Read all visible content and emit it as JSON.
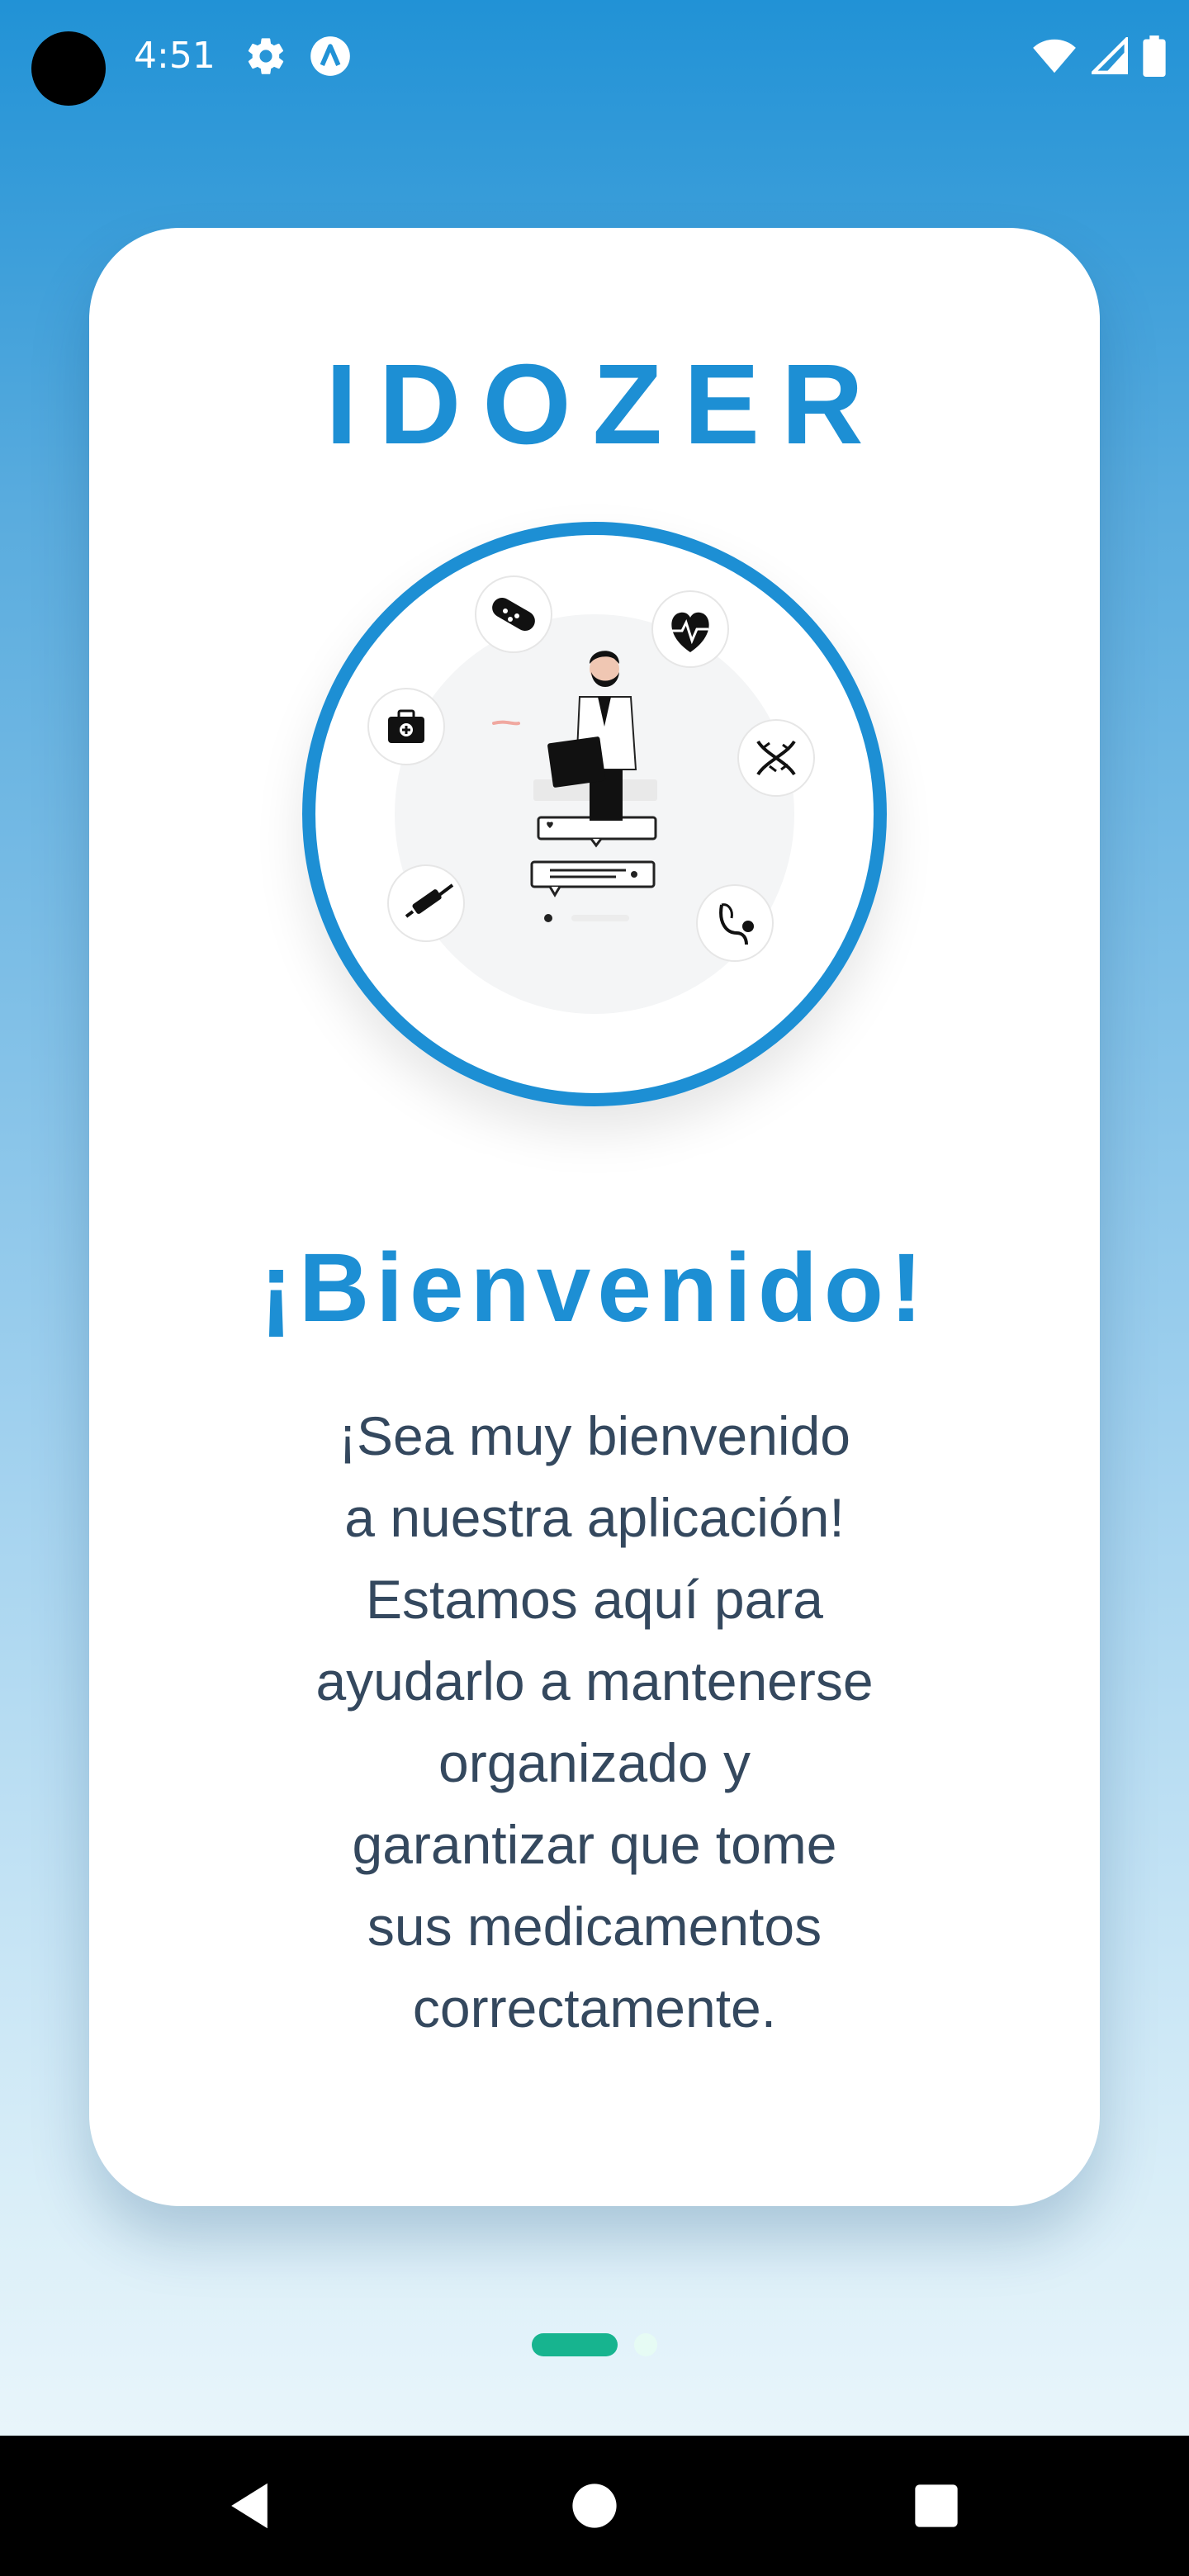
{
  "status_bar": {
    "time": "4:51",
    "icons": [
      "settings-icon",
      "app-notification-icon",
      "wifi-icon",
      "signal-icon",
      "battery-icon"
    ]
  },
  "card": {
    "app_title": "IDOZER",
    "welcome_heading": "¡Bienvenido!",
    "welcome_lines": [
      "¡Sea muy bienvenido",
      "a nuestra aplicación!",
      "Estamos aquí para",
      "ayudarlo a mantenerse",
      "organizado y",
      "garantizar que tome",
      "sus medicamentos",
      "correctamente."
    ]
  },
  "illustration": {
    "icons": [
      "bandage-icon",
      "heart-rate-icon",
      "medical-kit-icon",
      "dna-icon",
      "syringe-icon",
      "stethoscope-icon",
      "doctor-figure"
    ]
  },
  "pager": {
    "pages": 2,
    "active": 1
  },
  "nav_bar": {
    "buttons": [
      "back-icon",
      "home-icon",
      "recents-icon"
    ]
  },
  "colors": {
    "brand": "#1d8fd4",
    "body_text": "#34485e",
    "pager_active": "#17b48f",
    "pager_inactive": "#e6fbf4"
  }
}
